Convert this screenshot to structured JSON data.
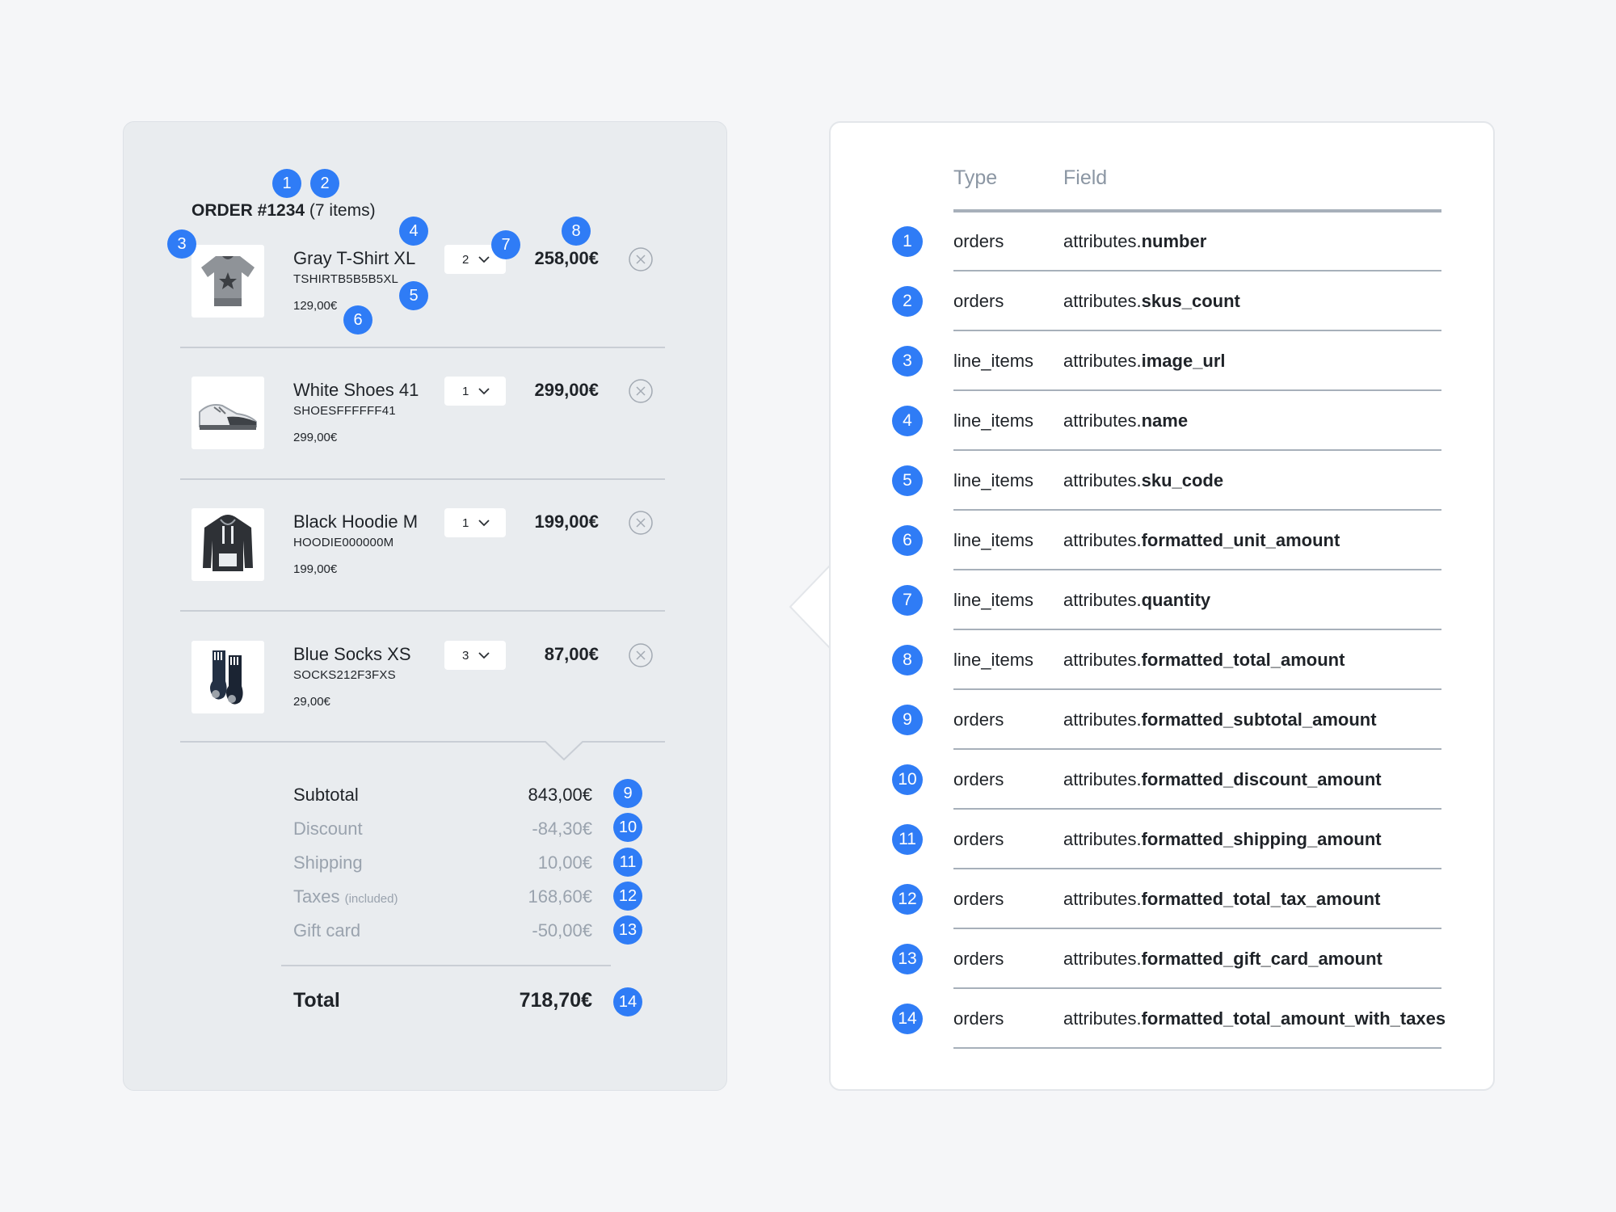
{
  "order": {
    "title_prefix": "ORDER #",
    "number": "1234",
    "items_text": "(7 items)",
    "line_items": [
      {
        "name": "Gray T-Shirt XL",
        "sku": "TSHIRTB5B5B5XL",
        "unit_price": "129,00€",
        "quantity": "2",
        "total": "258,00€",
        "image_icon": "tshirt-icon"
      },
      {
        "name": "White Shoes 41",
        "sku": "SHOESFFFFFF41",
        "unit_price": "299,00€",
        "quantity": "1",
        "total": "299,00€",
        "image_icon": "shoe-icon"
      },
      {
        "name": "Black Hoodie M",
        "sku": "HOODIE000000M",
        "unit_price": "199,00€",
        "quantity": "1",
        "total": "199,00€",
        "image_icon": "hoodie-icon"
      },
      {
        "name": "Blue Socks XS",
        "sku": "SOCKS212F3FXS",
        "unit_price": "29,00€",
        "quantity": "3",
        "total": "87,00€",
        "image_icon": "socks-icon"
      }
    ],
    "summary": {
      "subtotal": {
        "label": "Subtotal",
        "value": "843,00€"
      },
      "discount": {
        "label": "Discount",
        "value": "-84,30€"
      },
      "shipping": {
        "label": "Shipping",
        "value": "10,00€"
      },
      "taxes": {
        "label": "Taxes",
        "note": "(included)",
        "value": "168,60€"
      },
      "gift_card": {
        "label": "Gift card",
        "value": "-50,00€"
      },
      "total": {
        "label": "Total",
        "value": "718,70€"
      }
    }
  },
  "callouts": [
    "1",
    "2",
    "3",
    "4",
    "5",
    "6",
    "7",
    "8",
    "9",
    "10",
    "11",
    "12",
    "13",
    "14"
  ],
  "mapping": {
    "headers": {
      "type": "Type",
      "field": "Field"
    },
    "field_prefix": "attributes.",
    "rows": [
      {
        "badge": "1",
        "type": "orders",
        "field": "number"
      },
      {
        "badge": "2",
        "type": "orders",
        "field": "skus_count"
      },
      {
        "badge": "3",
        "type": "line_items",
        "field": "image_url"
      },
      {
        "badge": "4",
        "type": "line_items",
        "field": "name"
      },
      {
        "badge": "5",
        "type": "line_items",
        "field": "sku_code"
      },
      {
        "badge": "6",
        "type": "line_items",
        "field": "formatted_unit_amount"
      },
      {
        "badge": "7",
        "type": "line_items",
        "field": "quantity"
      },
      {
        "badge": "8",
        "type": "line_items",
        "field": "formatted_total_amount"
      },
      {
        "badge": "9",
        "type": "orders",
        "field": "formatted_subtotal_amount"
      },
      {
        "badge": "10",
        "type": "orders",
        "field": "formatted_discount_amount"
      },
      {
        "badge": "11",
        "type": "orders",
        "field": "formatted_shipping_amount"
      },
      {
        "badge": "12",
        "type": "orders",
        "field": "formatted_total_tax_amount"
      },
      {
        "badge": "13",
        "type": "orders",
        "field": "formatted_gift_card_amount"
      },
      {
        "badge": "14",
        "type": "orders",
        "field": "formatted_total_amount_with_taxes"
      }
    ]
  },
  "colors": {
    "badge": "#2f7cf6",
    "card_bg": "#e9ecef",
    "muted": "#9aa3ae"
  }
}
